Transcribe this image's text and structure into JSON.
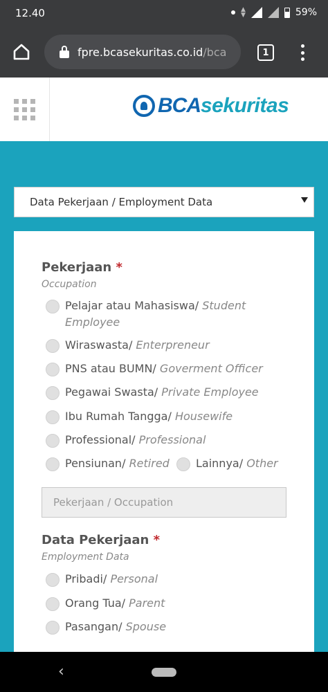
{
  "status": {
    "time": "12.40",
    "battery": "59%"
  },
  "browser": {
    "url_main": "fpre.bcasekuritas.co.id",
    "url_path": "/bca",
    "tab_count": "1"
  },
  "site": {
    "logo_bca": "BCA",
    "logo_sekuritas": "sekuritas"
  },
  "section": {
    "selected": "Data Pekerjaan / Employment Data"
  },
  "form": {
    "occupation": {
      "title": "Pekerjaan",
      "required_mark": "*",
      "subtitle": "Occupation",
      "options": [
        {
          "id": "Pelajar atau Mahasiswa/",
          "en": "Student"
        },
        {
          "id": "",
          "en": "Employee"
        },
        {
          "id": "Wiraswasta/",
          "en": "Enterpreneur"
        },
        {
          "id": "PNS atau BUMN/",
          "en": "Goverment Officer"
        },
        {
          "id": "Pegawai Swasta/",
          "en": "Private Employee"
        },
        {
          "id": "Ibu Rumah Tangga/",
          "en": "Housewife"
        },
        {
          "id": "Professional/",
          "en": "Professional"
        },
        {
          "id": "Pensiunan/",
          "en": "Retired"
        },
        {
          "id": "Lainnya/",
          "en": "Other"
        }
      ],
      "other_placeholder": "Pekerjaan / Occupation"
    },
    "employment": {
      "title": "Data Pekerjaan",
      "required_mark": "*",
      "subtitle": "Employment Data",
      "options": [
        {
          "id": "Pribadi/",
          "en": "Personal"
        },
        {
          "id": "Orang Tua/",
          "en": "Parent"
        },
        {
          "id": "Pasangan/",
          "en": "Spouse"
        }
      ]
    }
  }
}
